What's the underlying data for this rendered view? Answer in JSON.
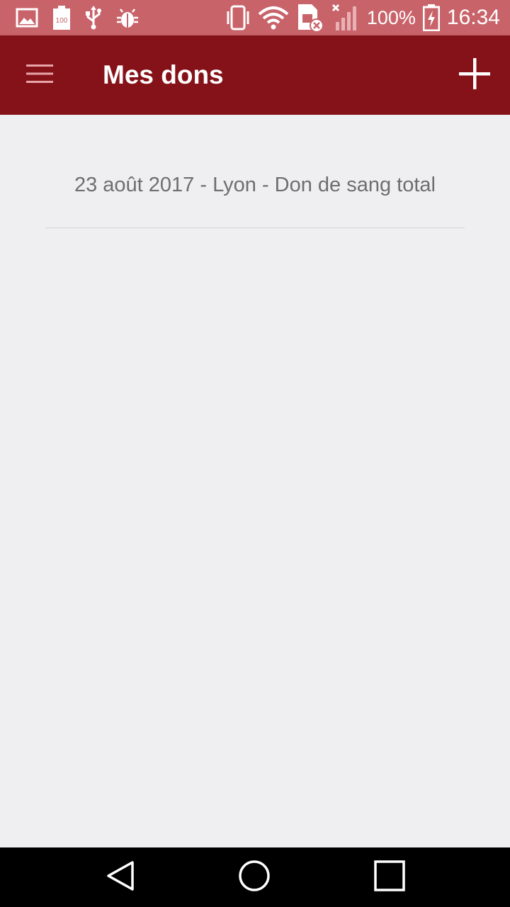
{
  "status_bar": {
    "battery_percent": "100%",
    "time": "16:34",
    "left_icons": [
      "image-icon",
      "battery-100-icon",
      "usb-icon",
      "bug-icon"
    ],
    "right_icons": [
      "vibrate-icon",
      "wifi-icon",
      "sim-error-icon",
      "signal-icon",
      "battery-charging-icon"
    ],
    "background_color": "#c8636a"
  },
  "app_bar": {
    "title": "Mes dons",
    "menu_icon": "menu-icon",
    "add_icon": "plus-icon",
    "background_color": "#861219"
  },
  "donations": [
    {
      "label": "23 août 2017 - Lyon - Don de sang total"
    }
  ],
  "nav_bar": {
    "icons": [
      "back-icon",
      "home-icon",
      "recents-icon"
    ],
    "background_color": "#000000"
  }
}
